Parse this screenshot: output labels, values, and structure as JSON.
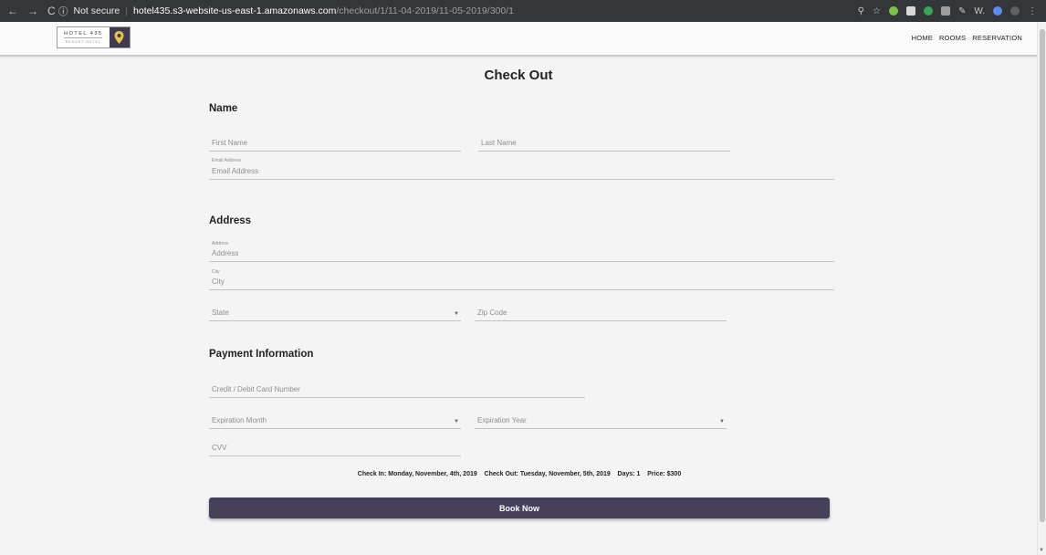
{
  "browser": {
    "security": "Not secure",
    "host": "hotel435.s3-website-us-east-1.amazonaws.com",
    "path": "/checkout/1/11-04-2019/11-05-2019/300/1",
    "ext_text": "W."
  },
  "logo": {
    "line1": "HOTEL 435",
    "line2": "RESORT HOTEL"
  },
  "nav": {
    "home": "HOME",
    "rooms": "ROOMS",
    "reservation": "RESERVATION"
  },
  "page": {
    "title": "Check Out"
  },
  "name_section": {
    "heading": "Name",
    "first_name": "First Name",
    "last_name": "Last Name",
    "email_label": "Email Address",
    "email": "Email Address"
  },
  "address_section": {
    "heading": "Address",
    "address_label": "Address",
    "address": "Address",
    "city_label": "City",
    "city": "City",
    "state": "State",
    "zip": "Zip Code"
  },
  "payment_section": {
    "heading": "Payment Information",
    "card": "Credit / Debit Card Number",
    "exp_month": "Expiration Month",
    "exp_year": "Expiration Year",
    "cvv": "CVV"
  },
  "summary": {
    "check_in": "Check In: Monday, November, 4th, 2019",
    "check_out": "Check Out: Tuesday, November, 5th, 2019",
    "days": "Days: 1",
    "price": "Price: $300"
  },
  "book_button": "Book Now",
  "colors": {
    "button": "#46405a",
    "logo_accent": "#e8c14a"
  }
}
